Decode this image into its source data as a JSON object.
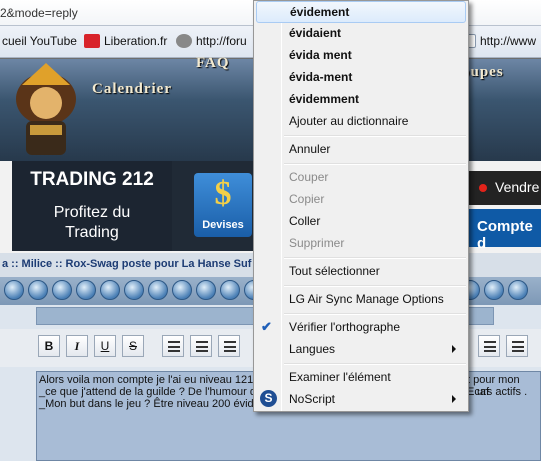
{
  "address_bar": {
    "url": "2&mode=reply"
  },
  "bookmarks": [
    {
      "label": "cueil YouTube",
      "icon": ""
    },
    {
      "label": "Liberation.fr",
      "icon": "liberation-icon"
    },
    {
      "label": "http://foru",
      "icon": "forum-icon"
    },
    {
      "label": "http://www",
      "icon": "page-icon"
    }
  ],
  "banner": {
    "nav_faq": "FAQ",
    "nav_calendrier": "Calendrier",
    "nav_groupes": "oupes"
  },
  "ad": {
    "title": "TRADING 212",
    "subtitle_line1": "Profitez du",
    "subtitle_line2": "Trading",
    "devises_label": "Devises",
    "vendre_label": "Vendre",
    "compte_label": "Compte d"
  },
  "breadcrumb": {
    "text": "a :: Milice :: Rox-Swag poste pour La Hanse Suf"
  },
  "editor": {
    "toolbar": {
      "bold": "B",
      "italic": "I",
      "underline": "U",
      "strike": "S"
    },
    "message_lines": [
      "Alors voila mon compte je l'ai eu niveau 121",
      "_ce que j'attend de la guilde ? De l'humour de",
      "_Mon but dans le jeu ? Être niveau 200 évida"
    ],
    "message_line_ends": [
      "t pour mon Ecaf",
      "urs actifs ."
    ]
  },
  "context_menu": {
    "suggestions": [
      "évidement",
      "évidaient",
      "évida ment",
      "évida-ment",
      "évidemment"
    ],
    "add_to_dictionary": "Ajouter au dictionnaire",
    "undo": "Annuler",
    "cut": "Couper",
    "copy": "Copier",
    "paste": "Coller",
    "delete": "Supprimer",
    "select_all": "Tout sélectionner",
    "lg_air_sync": "LG Air Sync Manage Options",
    "spellcheck": "Vérifier l'orthographe",
    "spellcheck_checked": true,
    "languages": "Langues",
    "inspect": "Examiner l'élément",
    "noscript": "NoScript"
  }
}
